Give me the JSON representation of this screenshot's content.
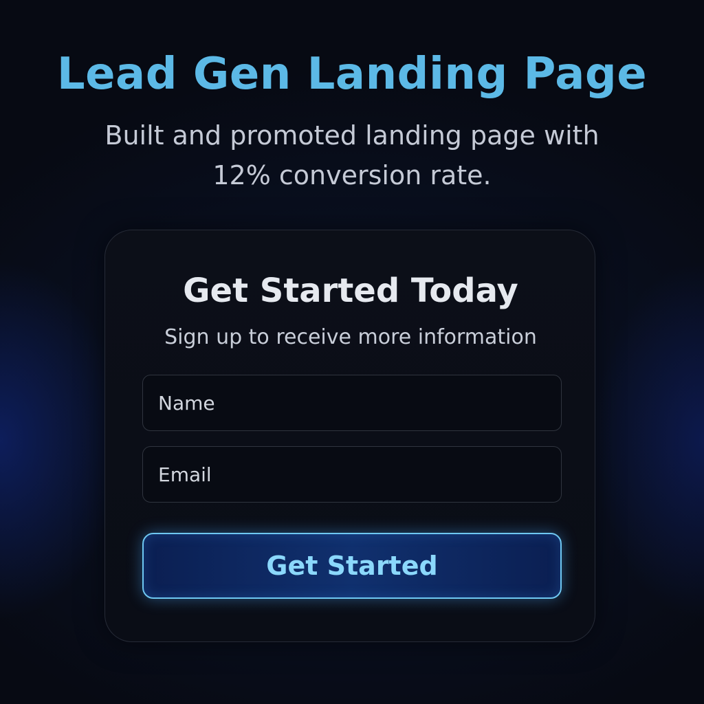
{
  "hero": {
    "title": "Lead Gen Landing Page",
    "subtitle": "Built and promoted landing page with 12% conversion rate."
  },
  "signup_card": {
    "title": "Get Started Today",
    "subtitle": "Sign up to receive more information",
    "name_field": {
      "placeholder": "Name",
      "value": ""
    },
    "email_field": {
      "placeholder": "Email",
      "value": ""
    },
    "submit_label": "Get Started"
  },
  "colors": {
    "background": "#070a13",
    "accent_title": "#5cb9e6",
    "button_border": "#6fc8f2",
    "button_text": "#8bd8fb",
    "button_fill": "#10306e"
  }
}
